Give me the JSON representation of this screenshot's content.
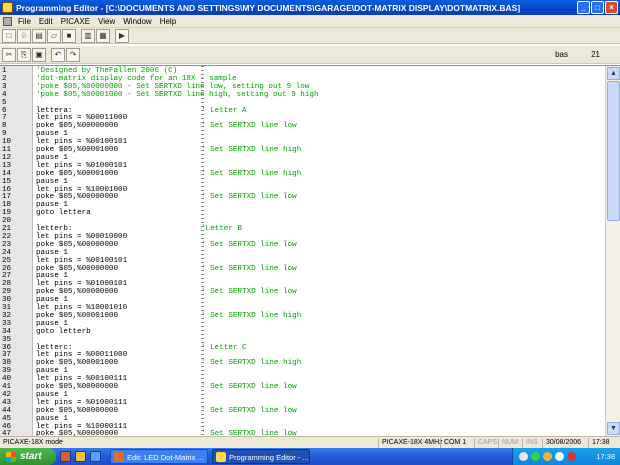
{
  "window": {
    "title": "Programming Editor - [C:\\DOCUMENTS AND SETTINGS\\MY DOCUMENTS\\GARAGE\\DOT-MATRIX DISPLAY\\DOTMATRIX.BAS]",
    "min_icon": "minimize-icon",
    "max_icon": "maximize-icon",
    "close_icon": "close-icon"
  },
  "menu": [
    "File",
    "Edit",
    "PICAXE",
    "View",
    "Window",
    "Help"
  ],
  "toolbar": {
    "bas_label": "bas",
    "line_count": "21"
  },
  "code_header": [
    {
      "n": "1",
      "c": "'Designed by TheFallen 2006 (C)"
    },
    {
      "n": "2",
      "c": "'dot-matrix display code for an 18X - sample"
    },
    {
      "n": "3",
      "c": "'poke $05,%00000000  - Set SERTXD line low, setting out 9 low"
    },
    {
      "n": "4",
      "c": "'poke $05,%00001000  - Set SERTXD line high, setting out 9 high"
    }
  ],
  "code_lines": [
    {
      "n": "5",
      "code": "",
      "cmt": ""
    },
    {
      "n": "6",
      "code": "lettera:",
      "cmt": "' Letter A"
    },
    {
      "n": "7",
      "code": "let pins = %00011000",
      "cmt": ""
    },
    {
      "n": "8",
      "code": "poke $05,%00000000",
      "cmt": "' Set SERTXD line low"
    },
    {
      "n": "9",
      "code": "pause 1",
      "cmt": ""
    },
    {
      "n": "10",
      "code": "let pins = %00100101",
      "cmt": ""
    },
    {
      "n": "11",
      "code": "poke $05,%00001000",
      "cmt": "' Set SERTXD line high"
    },
    {
      "n": "12",
      "code": "pause 1",
      "cmt": ""
    },
    {
      "n": "13",
      "code": "let pins = %01000101",
      "cmt": ""
    },
    {
      "n": "14",
      "code": "poke $05,%00001000",
      "cmt": "' Set SERTXD line high"
    },
    {
      "n": "15",
      "code": "pause 1",
      "cmt": ""
    },
    {
      "n": "16",
      "code": "let pins = %10001000",
      "cmt": ""
    },
    {
      "n": "17",
      "code": "poke $05,%00000000",
      "cmt": "' Set SERTXD line low"
    },
    {
      "n": "18",
      "code": "pause 1",
      "cmt": ""
    },
    {
      "n": "19",
      "code": "goto lettera",
      "cmt": ""
    },
    {
      "n": "20",
      "code": "",
      "cmt": ""
    },
    {
      "n": "21",
      "code": "letterb:",
      "cmt": "'Letter B"
    },
    {
      "n": "22",
      "code": "let pins = %00010000",
      "cmt": ""
    },
    {
      "n": "23",
      "code": "poke $05,%00000000",
      "cmt": "' Set SERTXD line low"
    },
    {
      "n": "24",
      "code": "pause 1",
      "cmt": ""
    },
    {
      "n": "25",
      "code": "let pins = %00100101",
      "cmt": ""
    },
    {
      "n": "26",
      "code": "poke $05,%00000000",
      "cmt": "' Set SERTXD line low"
    },
    {
      "n": "27",
      "code": "pause 1",
      "cmt": ""
    },
    {
      "n": "28",
      "code": "let pins = %01000101",
      "cmt": ""
    },
    {
      "n": "29",
      "code": "poke $05,%00000000",
      "cmt": "' Set SERTXD line low"
    },
    {
      "n": "30",
      "code": "pause 1",
      "cmt": ""
    },
    {
      "n": "31",
      "code": "let pins = %10001010",
      "cmt": ""
    },
    {
      "n": "32",
      "code": "poke $05,%00001000",
      "cmt": "' Set SERTXD line high"
    },
    {
      "n": "33",
      "code": "pause 1",
      "cmt": ""
    },
    {
      "n": "34",
      "code": "goto letterb",
      "cmt": ""
    },
    {
      "n": "35",
      "code": "",
      "cmt": ""
    },
    {
      "n": "36",
      "code": "letterc:",
      "cmt": "' Letter C"
    },
    {
      "n": "37",
      "code": "let pins = %00011000",
      "cmt": ""
    },
    {
      "n": "38",
      "code": "poke $05,%00001000",
      "cmt": "' Set SERTXD line high"
    },
    {
      "n": "39",
      "code": "pause 1",
      "cmt": ""
    },
    {
      "n": "40",
      "code": "let pins = %00100111",
      "cmt": ""
    },
    {
      "n": "41",
      "code": "poke $05,%00000000",
      "cmt": "' Set SERTXD line low"
    },
    {
      "n": "42",
      "code": "pause 1",
      "cmt": ""
    },
    {
      "n": "43",
      "code": "let pins = %01000111",
      "cmt": ""
    },
    {
      "n": "44",
      "code": "poke $05,%00000000",
      "cmt": "' Set SERTXD line low"
    },
    {
      "n": "45",
      "code": "pause 1",
      "cmt": ""
    },
    {
      "n": "46",
      "code": "let pins = %10000111",
      "cmt": ""
    },
    {
      "n": "47",
      "code": "poke $05,%00000000",
      "cmt": "' Set SERTXD line low"
    }
  ],
  "status": {
    "mode": "PICAXE-18X mode",
    "chip": "PICAXE-18X 4MHz",
    "port": "COM 1",
    "caps": "CAPS",
    "num": "NUM",
    "ins": "INS",
    "date": "30/08/2006",
    "time": "17:38"
  },
  "taskbar": {
    "start": "start",
    "tasks": [
      "Edit: LED Dot-Matrix ...",
      "Programming Editor - ..."
    ],
    "clock": "17:38"
  }
}
